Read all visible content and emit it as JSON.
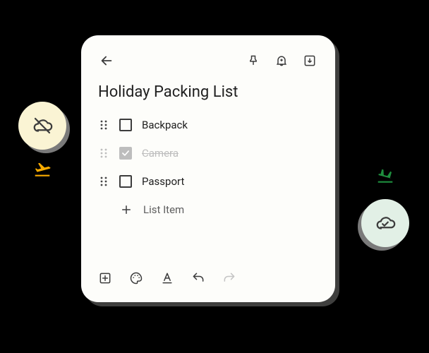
{
  "title": "Holiday Packing List",
  "items": [
    {
      "text": "Backpack",
      "checked": false
    },
    {
      "text": "Camera",
      "checked": true
    },
    {
      "text": "Passport",
      "checked": false
    }
  ],
  "addItemPlaceholder": "List Item",
  "icons": {
    "back": "arrow-back",
    "pin": "push-pin",
    "reminder": "bell-add",
    "archive": "archive",
    "addBox": "add-box",
    "palette": "palette",
    "textFormat": "format-a",
    "undo": "undo",
    "redo": "redo",
    "offline": "cloud-off",
    "online": "cloud-done",
    "depart": "flight-takeoff",
    "arrive": "flight-land"
  }
}
